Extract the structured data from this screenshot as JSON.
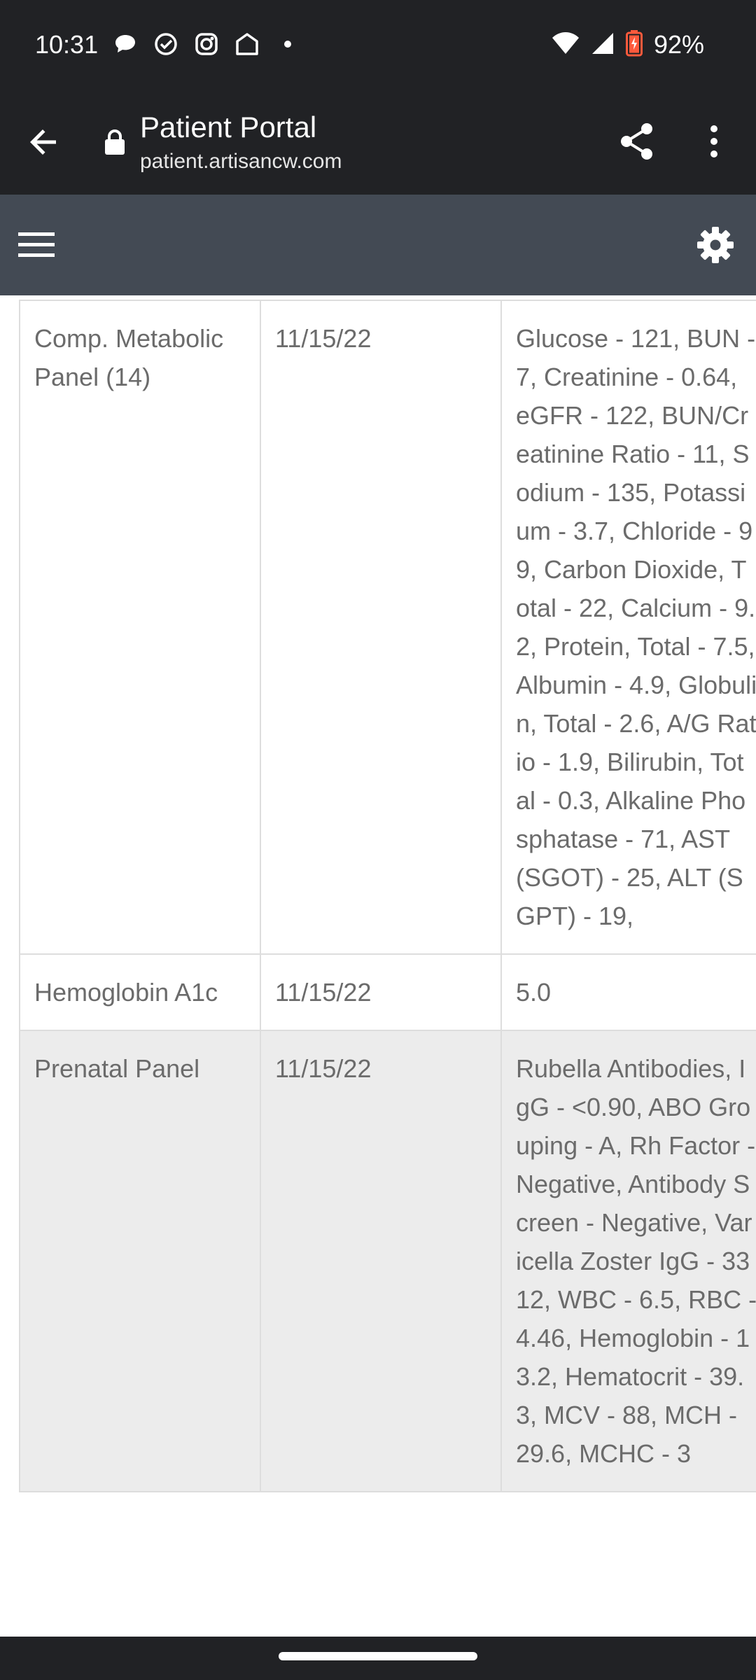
{
  "status_bar": {
    "time": "10:31",
    "battery": "92%",
    "left_icons": [
      "messages-icon",
      "check-circle-icon",
      "photos-icon",
      "home-icon",
      "dot-icon"
    ],
    "right_icons": [
      "wifi-icon",
      "signal-icon",
      "battery-icon"
    ]
  },
  "browser": {
    "title": "Patient Portal",
    "url": "patient.artisancw.com"
  },
  "results": {
    "rows": [
      {
        "test": "Comp. Metabolic Panel (14)",
        "date": "11/15/22",
        "result": "Glucose - 121, BUN - 7, Creatinine - 0.64, eGFR - 122, BUN/Creatinine Ratio - 11, Sodium - 135, Potassium - 3.7, Chloride - 99, Carbon Dioxide, Total - 22, Calcium - 9.2, Protein, Total - 7.5, Albumin - 4.9, Globulin, Total - 2.6, A/G Ratio - 1.9, Bilirubin, Total - 0.3, Alkaline Phosphatase - 71, AST (SGOT) - 25, ALT (SGPT) - 19,"
      },
      {
        "test": "Hemoglobin A1c",
        "date": "11/15/22",
        "result": "5.0"
      },
      {
        "test": "Prenatal Panel",
        "date": "11/15/22",
        "result": "Rubella Antibodies, IgG - <0.90, ABO Grouping - A, Rh Factor - Negative, Antibody Screen - Negative, Varicella Zoster IgG - 3312, WBC - 6.5, RBC - 4.46, Hemoglobin - 13.2, Hematocrit - 39.3, MCV - 88, MCH - 29.6, MCHC - 3"
      }
    ]
  }
}
